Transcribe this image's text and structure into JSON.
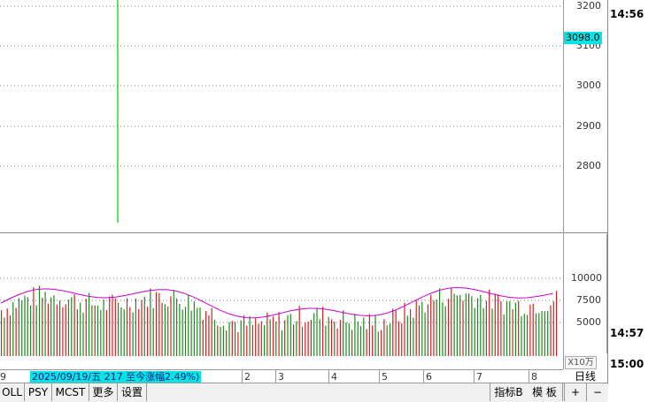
{
  "price_axis": {
    "labels": [
      "3200",
      "3100",
      "3000",
      "2900",
      "2800"
    ],
    "current_price": "3098.0"
  },
  "volume_axis": {
    "labels": [
      "10000",
      "7500",
      "5000"
    ],
    "unit": "X10万"
  },
  "time_column": {
    "top": "14:56",
    "middle": "14:57",
    "bottom": "15:00"
  },
  "date_strip": {
    "marks": [
      "9",
      "2",
      "3",
      "4",
      "5",
      "6",
      "7",
      "8"
    ],
    "info": "2025/09/19/五 217 至今涨幅2.49%)"
  },
  "period": "日线",
  "tabs": [
    "OLL",
    "PSY",
    "MCST",
    "更多",
    "设置"
  ],
  "right_buttons": [
    "指标B",
    "模 板"
  ],
  "zoom_buttons": [
    "+",
    "−"
  ],
  "colors": {
    "accent": "#00e5e5",
    "up_bar": "#d42020",
    "down_bar": "#1e8a1e",
    "ma_line": "#cc00cc",
    "cursor_line": "#00cc00"
  }
}
